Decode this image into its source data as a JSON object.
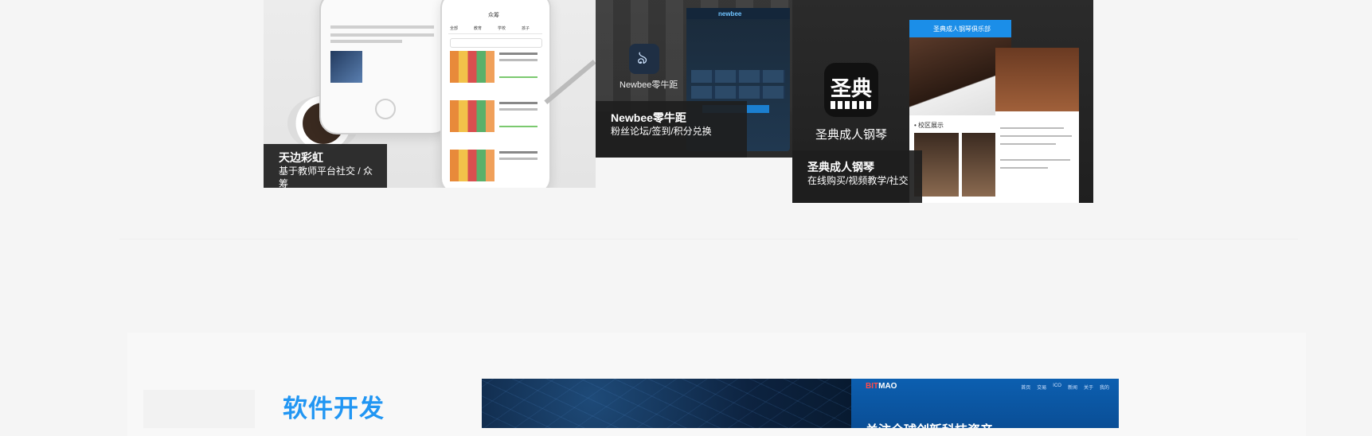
{
  "tiles": [
    {
      "title": "天边彩虹",
      "subtitle": "基于教师平台社交 / 众筹",
      "phone_header": "众筹",
      "phone_tabs": [
        "全部",
        "教育",
        "学校",
        "孩子"
      ]
    },
    {
      "title": "Newbee零牛距",
      "subtitle": "粉丝论坛/签到/积分兑换",
      "app_name": "Newbee零牛距",
      "phone_logo": "newbee"
    },
    {
      "title": "圣典成人钢琴",
      "subtitle": "在线购买/视频教学/社交",
      "app_icon_text": "圣典",
      "app_name": "圣典成人钢琴",
      "phone_header": "圣典成人钢琴俱乐部",
      "phone_section": "• 校区展示"
    }
  ],
  "section": {
    "title": "软件开发"
  },
  "website": {
    "logo_accent": "BIT",
    "logo_rest": "MAO",
    "headline": "关注全球创新科技资产",
    "nav": [
      "首页",
      "交易",
      "ICO",
      "新闻",
      "关于",
      "我的"
    ]
  },
  "colors": {
    "accent_blue": "#2196f3",
    "caption_bg": "#1e1e1e"
  }
}
